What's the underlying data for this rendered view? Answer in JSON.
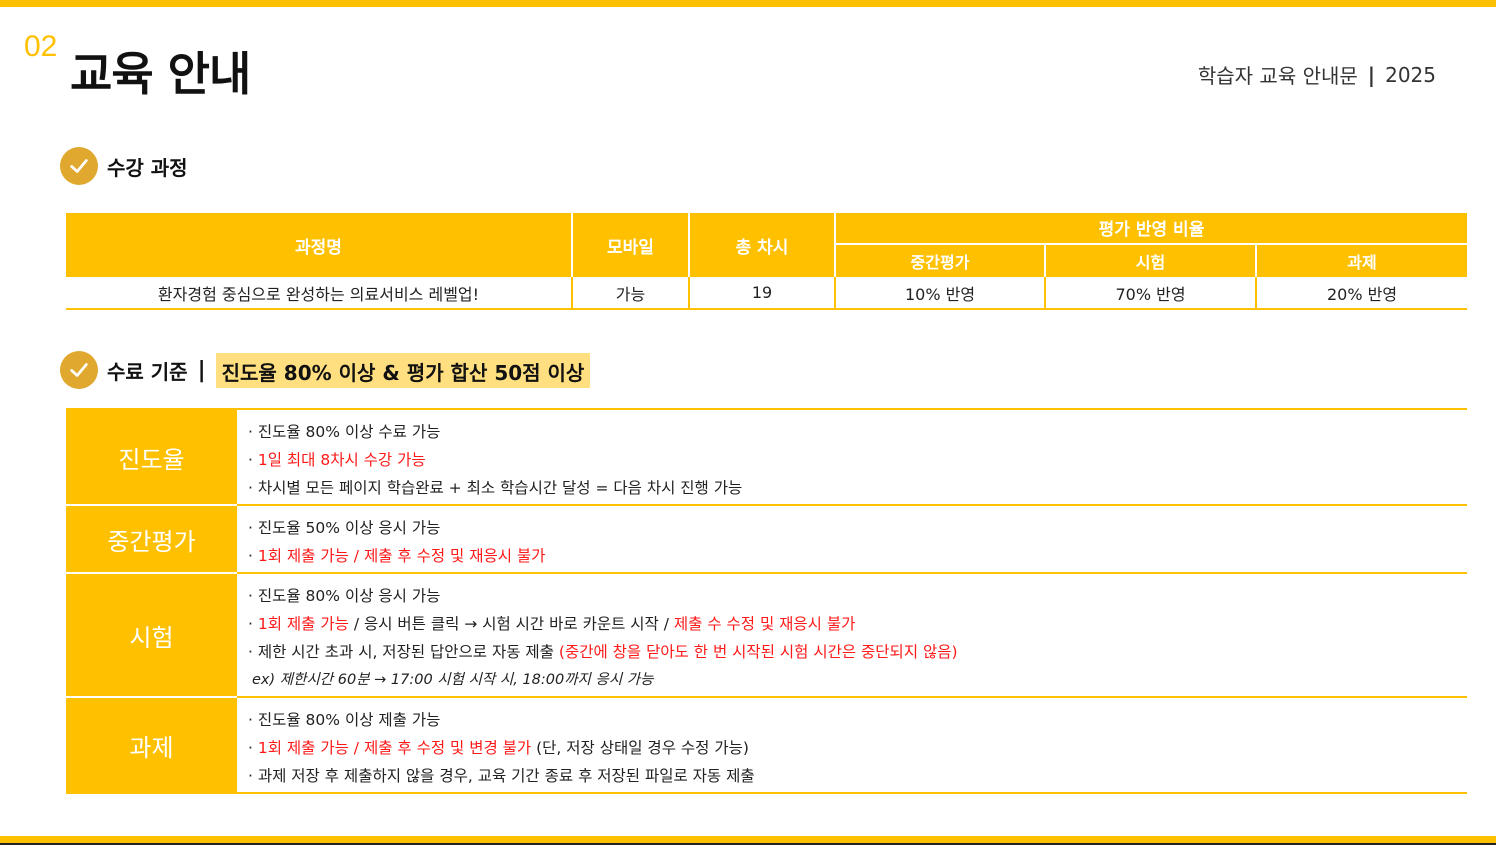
{
  "header": {
    "section_number": "02",
    "title": "교육 안내",
    "doc_name": "학습자 교육 안내문",
    "separator": "|",
    "year": "2025"
  },
  "course_section": {
    "title": "수강 과정",
    "table": {
      "col_course": "과정명",
      "col_mobile": "모바일",
      "col_sessions": "총 차시",
      "col_eval_group": "평가 반영 비율",
      "col_midterm": "중간평가",
      "col_exam": "시험",
      "col_assignment": "과제",
      "row": {
        "course": "환자경험 중심으로 완성하는 의료서비스 레벨업!",
        "mobile": "가능",
        "sessions": "19",
        "midterm": "10% 반영",
        "exam": "70% 반영",
        "assignment": "20% 반영"
      }
    }
  },
  "completion_section": {
    "title": "수료 기준",
    "separator": "|",
    "highlight": "진도율 80% 이상 & 평가 합산 50점 이상",
    "rows": [
      {
        "label": "진도율",
        "lines": [
          {
            "a": "· 진도율 80% 이상 수료 가능"
          },
          {
            "p": "· ",
            "r": "1일 최대 8차시 수강 가능"
          },
          {
            "a": "· 차시별 모든 페이지 학습완료 + 최소 학습시간 달성 = 다음 차시 진행 가능"
          }
        ]
      },
      {
        "label": "중간평가",
        "lines": [
          {
            "a": "· 진도율 50% 이상 응시 가능"
          },
          {
            "p": "· ",
            "r": "1회 제출 가능 / 제출 후 수정 및 재응시 불가"
          }
        ]
      },
      {
        "label": "시험",
        "lines": [
          {
            "a": "· 진도율 80% 이상 응시 가능"
          },
          {
            "p": "· ",
            "r": "1회 제출 가능",
            "b": " / 응시 버튼 클릭 → 시험 시간 바로 카운트 시작 / ",
            "r2": "제출 수 수정 및 재응시 불가"
          },
          {
            "a": "· 제한 시간 초과 시, 저장된 답안으로 자동 제출 ",
            "r": "(중간에 창을 닫아도 한 번 시작된 시험 시간은 중단되지 않음)"
          },
          {
            "ex": "ex) 제한시간 60분 → 17:00 시험 시작 시, 18:00까지 응시 가능"
          }
        ]
      },
      {
        "label": "과제",
        "lines": [
          {
            "a": "· 진도율 80% 이상 제출 가능"
          },
          {
            "p": "· ",
            "r": "1회 제출 가능 / 제출 후 수정 및 변경 불가",
            "b": " (단, 저장 상태일 경우 수정 가능)"
          },
          {
            "a": "· 과제 저장 후 제출하지 않을 경우, 교육 기간 종료 후 저장된 파일로 자동 제출"
          }
        ]
      }
    ]
  },
  "colors": {
    "accent": "#FFC000",
    "check_circle": "#E0A82E",
    "highlight_bg": "#FFDF80",
    "warning_text": "#FF1A1A"
  },
  "icons": [
    "check-icon"
  ]
}
